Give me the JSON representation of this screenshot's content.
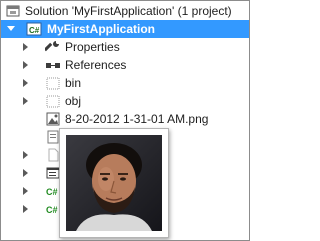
{
  "solution_explorer": {
    "solution": {
      "label": "Solution 'MyFirstApplication' (1 project)",
      "icon": "solution-icon"
    },
    "project": {
      "label": "MyFirstApplication",
      "icon": "csharp-project-icon",
      "expanded": true,
      "selected": true
    },
    "items": [
      {
        "label": "Properties",
        "icon": "wrench-icon"
      },
      {
        "label": "References",
        "icon": "references-icon"
      },
      {
        "label": "bin",
        "icon": "folder-dotted-icon"
      },
      {
        "label": "obj",
        "icon": "folder-dotted-icon"
      },
      {
        "label": "8-20-2012 1-31-01 AM.png",
        "icon": "image-file-icon"
      }
    ],
    "hidden_items": [
      {
        "icon": "config-file-icon"
      },
      {
        "icon": "file-icon"
      },
      {
        "icon": "form-icon"
      },
      {
        "icon": "csharp-file-icon",
        "glyph": "C#"
      },
      {
        "icon": "csharp-file-icon",
        "glyph": "C#"
      }
    ],
    "preview": {
      "icon": "image-preview-icon"
    }
  },
  "colors": {
    "selection": "#3399ff",
    "csharp_green": "#1f8a1f"
  }
}
